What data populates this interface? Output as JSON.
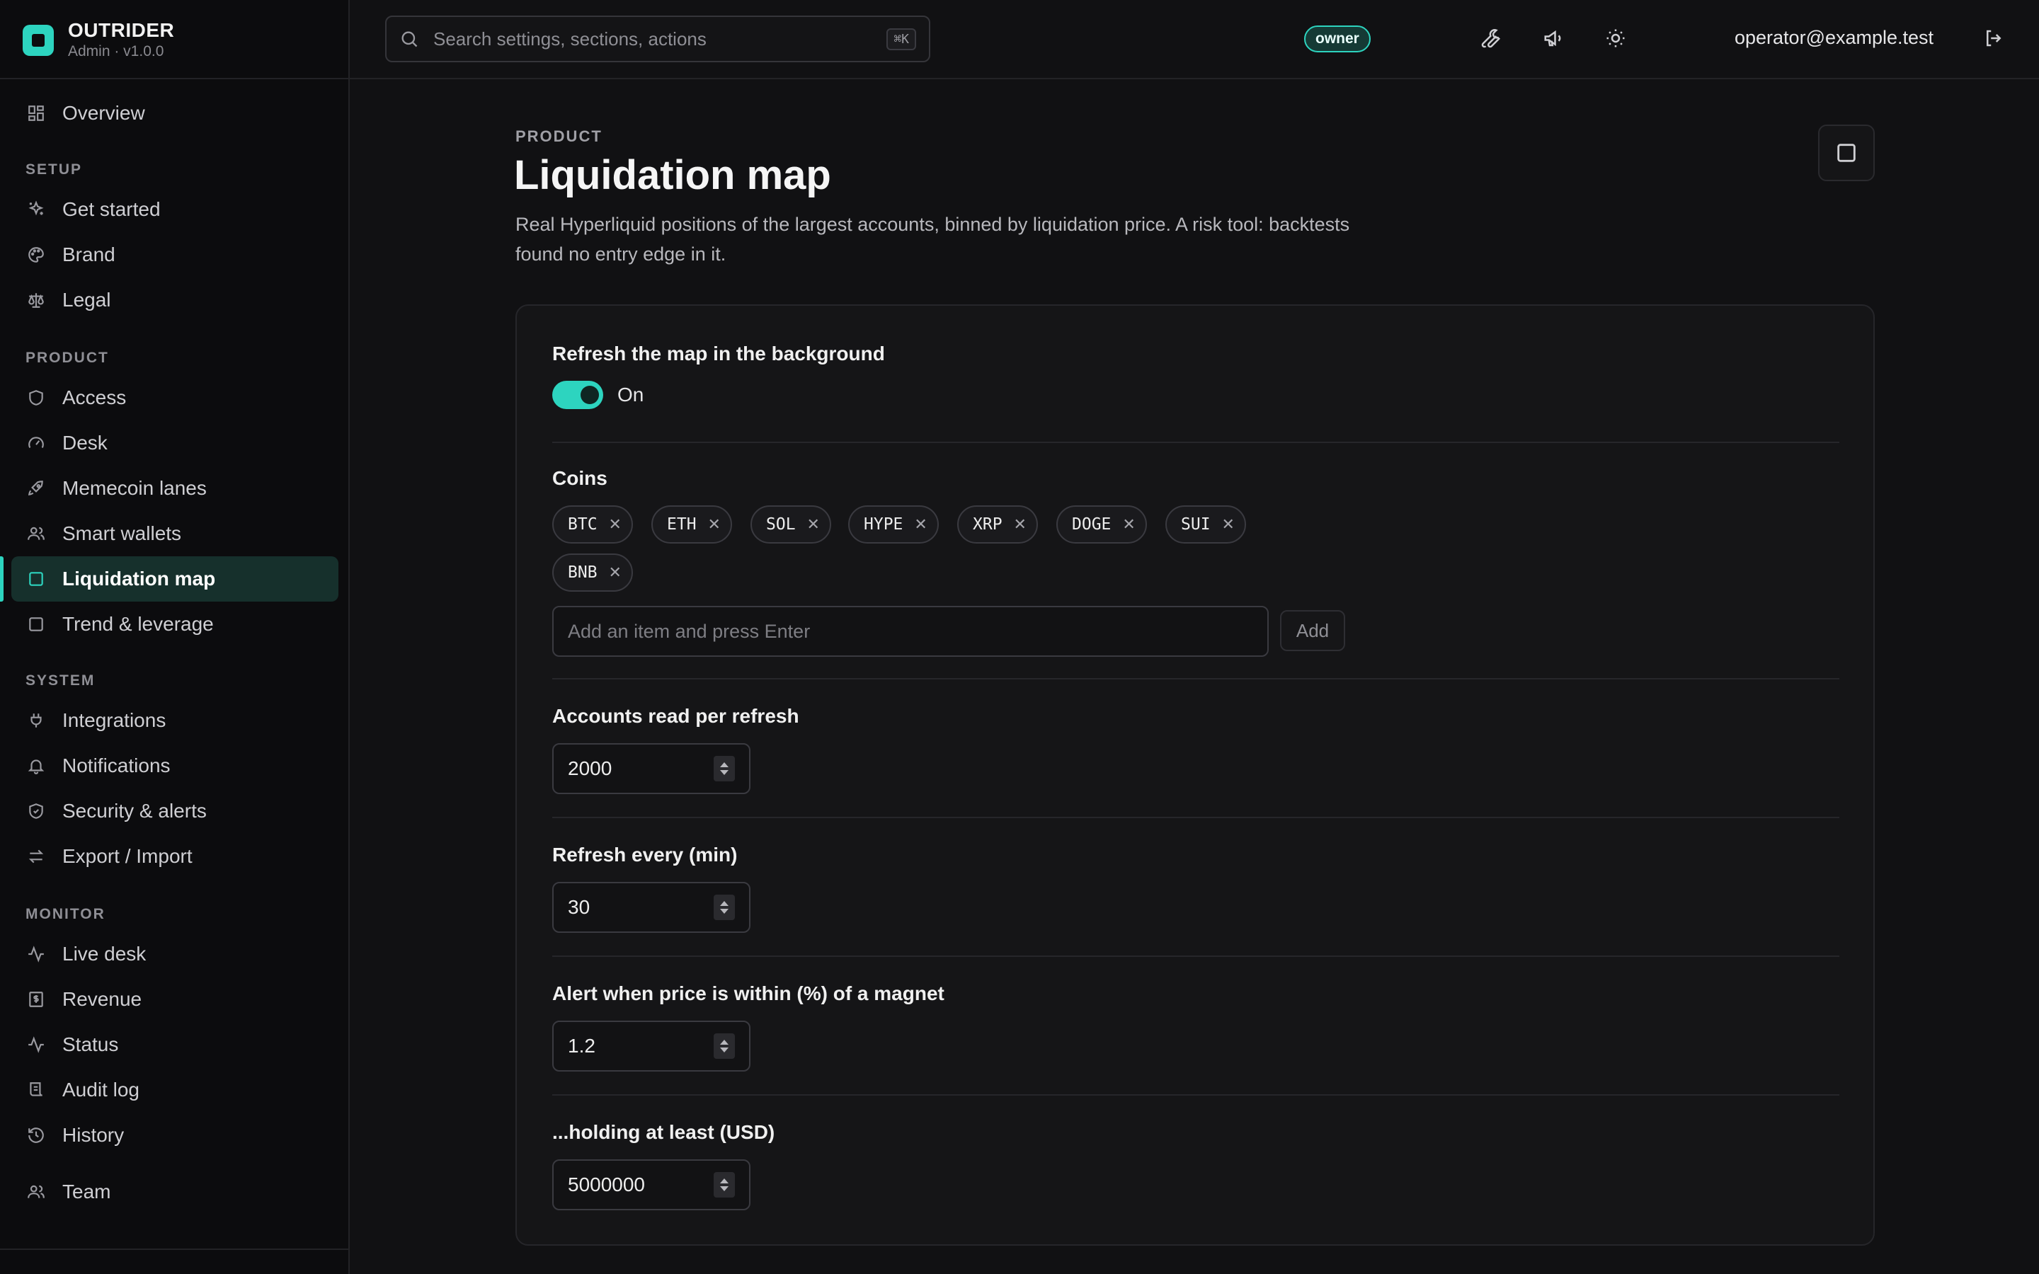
{
  "brand": {
    "name": "OUTRIDER",
    "version": "Admin · v1.0.0"
  },
  "colors": {
    "accent": "#2dd4bf",
    "background": "#111113",
    "sidebar": "#0c0c0e"
  },
  "sidebar": {
    "overview": {
      "label": "Overview",
      "icon": "grid-icon"
    },
    "sections": [
      {
        "label": "SETUP",
        "items": [
          {
            "label": "Get started",
            "icon": "sparkles-icon"
          },
          {
            "label": "Brand",
            "icon": "palette-icon"
          },
          {
            "label": "Legal",
            "icon": "scale-icon"
          }
        ]
      },
      {
        "label": "PRODUCT",
        "items": [
          {
            "label": "Access",
            "icon": "shield-icon"
          },
          {
            "label": "Desk",
            "icon": "gauge-icon"
          },
          {
            "label": "Memecoin lanes",
            "icon": "rocket-icon"
          },
          {
            "label": "Smart wallets",
            "icon": "users-icon"
          },
          {
            "label": "Liquidation map",
            "icon": "square-icon",
            "active": true
          },
          {
            "label": "Trend & leverage",
            "icon": "square-icon"
          }
        ]
      },
      {
        "label": "SYSTEM",
        "items": [
          {
            "label": "Integrations",
            "icon": "plug-icon"
          },
          {
            "label": "Notifications",
            "icon": "bell-icon"
          },
          {
            "label": "Security & alerts",
            "icon": "shield-check-icon"
          },
          {
            "label": "Export / Import",
            "icon": "arrows-swap-icon"
          }
        ]
      },
      {
        "label": "MONITOR",
        "items": [
          {
            "label": "Live desk",
            "icon": "activity-icon"
          },
          {
            "label": "Revenue",
            "icon": "receipt-dollar-icon"
          },
          {
            "label": "Status",
            "icon": "activity-icon"
          },
          {
            "label": "Audit log",
            "icon": "receipt-icon"
          },
          {
            "label": "History",
            "icon": "history-icon"
          }
        ]
      }
    ],
    "team": {
      "label": "Team",
      "icon": "users-icon"
    }
  },
  "header": {
    "search_placeholder": "Search settings, sections, actions",
    "search_shortcut": "⌘K",
    "role_badge": "owner",
    "user_email": "operator@example.test",
    "icons": [
      "wrench-icon",
      "megaphone-icon",
      "sun-icon",
      "logout-icon"
    ]
  },
  "page": {
    "eyebrow": "PRODUCT",
    "title": "Liquidation map",
    "description": "Real Hyperliquid positions of the largest accounts, binned by liquidation price. A risk tool: backtests found no entry edge in it."
  },
  "form": {
    "refresh_bg": {
      "label": "Refresh the map in the background",
      "state_label": "On",
      "value": true
    },
    "coins": {
      "label": "Coins",
      "items": [
        "BTC",
        "ETH",
        "SOL",
        "HYPE",
        "XRP",
        "DOGE",
        "SUI",
        "BNB"
      ],
      "input_placeholder": "Add an item and press Enter",
      "add_label": "Add"
    },
    "accounts": {
      "label": "Accounts read per refresh",
      "value": "2000"
    },
    "refresh_every": {
      "label": "Refresh every (min)",
      "value": "30"
    },
    "alert_within": {
      "label": "Alert when price is within (%) of a magnet",
      "value": "1.2"
    },
    "holding_min": {
      "label": "...holding at least (USD)",
      "value": "5000000"
    }
  }
}
